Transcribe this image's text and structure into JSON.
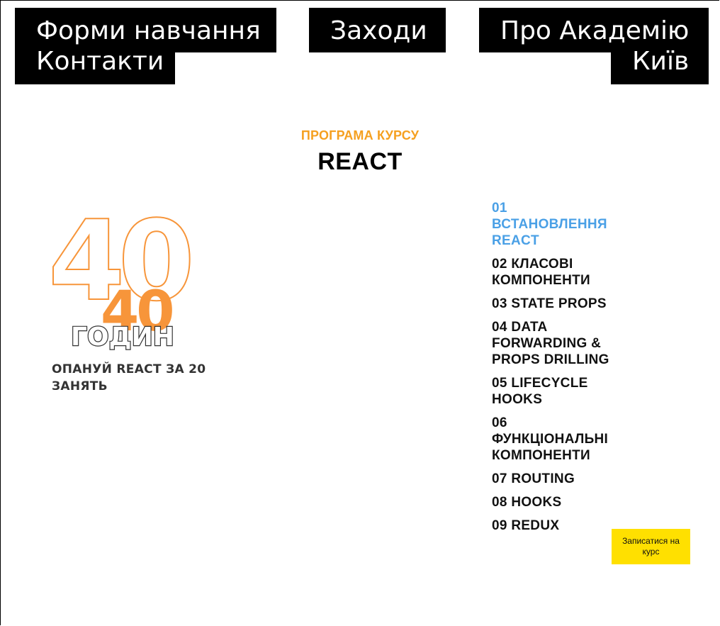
{
  "nav": {
    "forms": "Форми навчання",
    "contacts": "Контакти",
    "events": "Заходи",
    "about": "Про Академію",
    "city": "Київ"
  },
  "section": {
    "eyebrow": "ПРОГРАМА КУРСУ",
    "title": "REACT"
  },
  "hours": {
    "outline_number": "40",
    "number": "40",
    "unit": "годин",
    "tagline": "ОПАНУЙ REACT ЗА 20 ЗАНЯТЬ"
  },
  "program": {
    "items": [
      "01 ВСТАНОВЛЕННЯ REACT",
      "02 КЛАСОВІ КОМПОНЕНТИ",
      "03 STATE PROPS",
      "04 DATA FORWARDING & PROPS DRILLING",
      "05 LIFECYCLE HOOKS",
      "06 ФУНКЦІОНАЛЬНІ КОМПОНЕНТИ",
      "07 ROUTING",
      "08 HOOKS",
      "09 REDUX"
    ],
    "active_index": 0
  },
  "cta": {
    "enroll": "Записатися на курс"
  },
  "colors": {
    "accent_orange": "#f5a020",
    "graphic_orange": "#f7953a",
    "active_blue": "#4aa0e6",
    "button_yellow": "#ffe000"
  }
}
